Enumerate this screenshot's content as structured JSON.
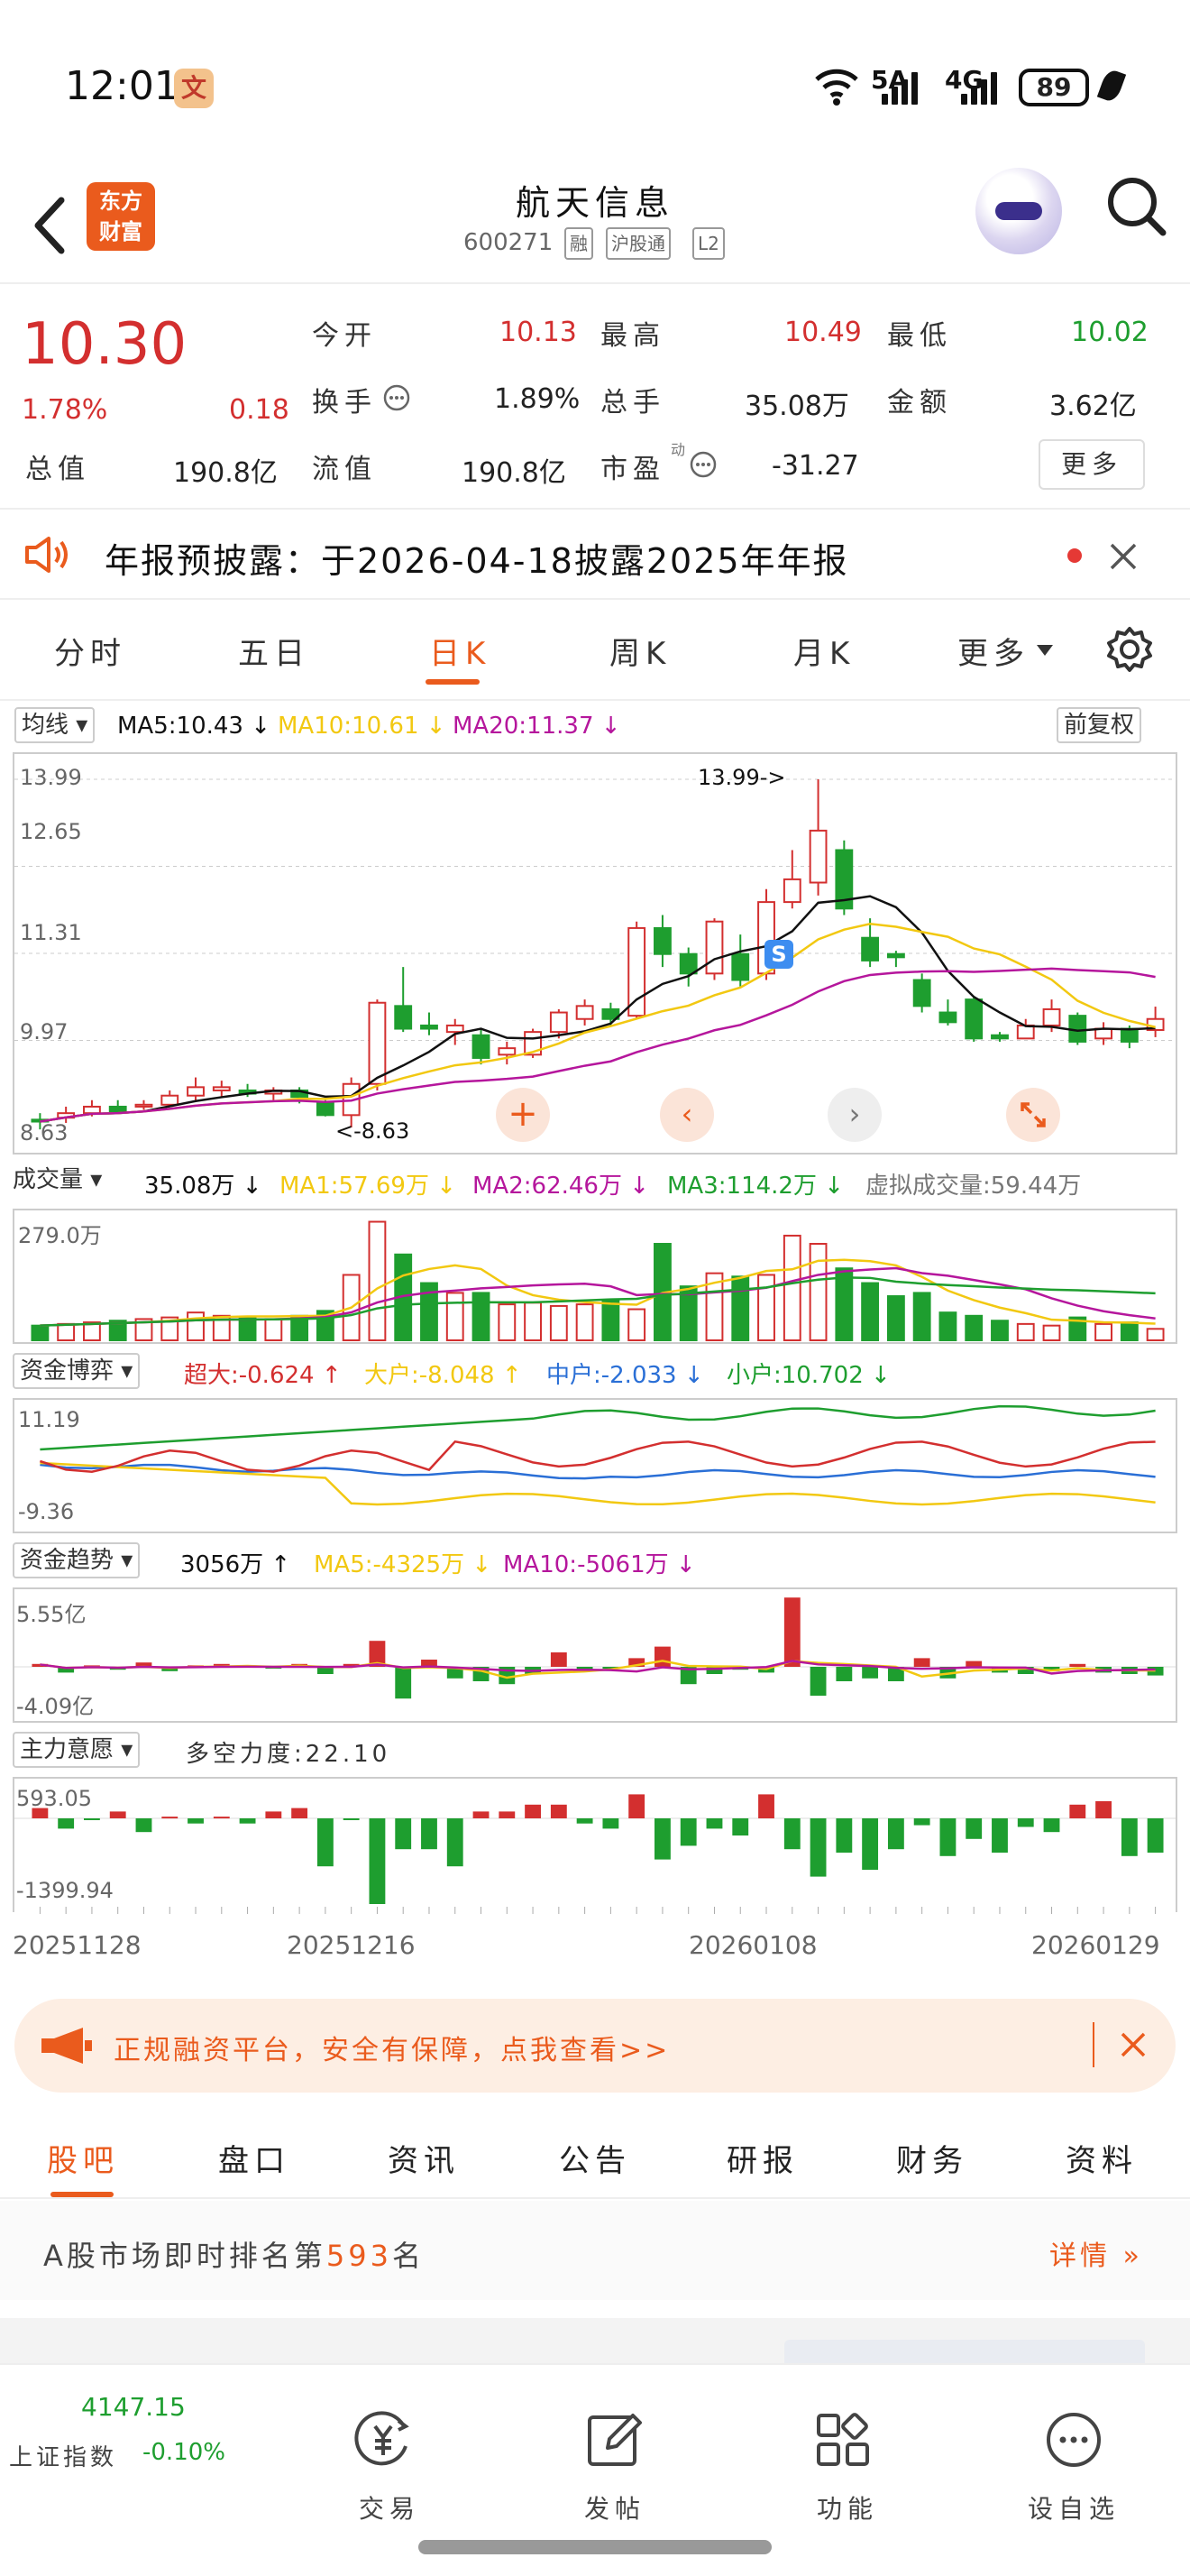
{
  "status": {
    "time": "12:01",
    "app_badge": "文",
    "net1": "5A",
    "net2": "4G",
    "battery": "89"
  },
  "header": {
    "title": "航天信息",
    "code": "600271",
    "tags": [
      "融",
      "沪股通",
      "L2"
    ],
    "logo_line1": "东方",
    "logo_line2": "财富"
  },
  "quote": {
    "price": "10.30",
    "change_pct": "1.78%",
    "change": "0.18",
    "open_label": "今开",
    "open": "10.13",
    "high_label": "最高",
    "high": "10.49",
    "low_label": "最低",
    "low": "10.02",
    "turnover_label": "换手",
    "turnover": "1.89%",
    "volume_label": "总手",
    "volume": "35.08万",
    "amount_label": "金额",
    "amount": "3.62亿",
    "mktcap_label": "总值",
    "mktcap": "190.8亿",
    "float_label": "流值",
    "float": "190.8亿",
    "pe_label": "市盈",
    "pe_sup": "动",
    "pe": "-31.27",
    "more": "更多"
  },
  "notice": {
    "text": "年报预披露：于2026-04-18披露2025年年报"
  },
  "ktabs": [
    "分时",
    "五日",
    "日K",
    "周K",
    "月K",
    "更多"
  ],
  "ma": {
    "selector": "均线",
    "ma5": "MA5:10.43",
    "ma10": "MA10:10.61",
    "ma20": "MA20:11.37",
    "adjust": "前复权"
  },
  "kchart": {
    "y_labels": [
      "13.99",
      "12.65",
      "11.31",
      "9.97",
      "8.63"
    ],
    "max_marker": "13.99->",
    "min_marker": "<-8.63",
    "s_marker": "S"
  },
  "vol": {
    "selector": "成交量",
    "value": "35.08万",
    "ma1": "MA1:57.69万",
    "ma2": "MA2:62.46万",
    "ma3": "MA3:114.2万",
    "virtual": "虚拟成交量:59.44万",
    "ymax": "279.0万"
  },
  "game": {
    "selector": "资金博弈",
    "xl": "超大:-0.624",
    "l": "大户:-8.048",
    "m": "中户:-2.033",
    "s": "小户:10.702",
    "ymax": "11.19",
    "ymin": "-9.36"
  },
  "trend": {
    "selector": "资金趋势",
    "value": "3056万",
    "ma5": "MA5:-4325万",
    "ma10": "MA10:-5061万",
    "ymax": "5.55亿",
    "ymin": "-4.09亿"
  },
  "will": {
    "selector": "主力意愿",
    "text": "多空力度:22.10",
    "ymax": "593.05",
    "ymin": "-1399.94"
  },
  "dates": [
    "20251128",
    "20251216",
    "20260108",
    "20260129"
  ],
  "promo": {
    "text": "正规融资平台，安全有保障，点我查看>>"
  },
  "ctabs": [
    "股吧",
    "盘口",
    "资讯",
    "公告",
    "研报",
    "财务",
    "资料"
  ],
  "rank": {
    "prefix": "A股市场即时排名第",
    "num": "593",
    "suffix": "名",
    "detail": "详情"
  },
  "bottom": {
    "index_value": "4147.15",
    "index_name": "上证指数",
    "index_pct": "-0.10%",
    "nav": [
      "交易",
      "发帖",
      "功能",
      "设自选"
    ]
  },
  "colors": {
    "up": "#d32f2f",
    "down": "#1e9e2f",
    "accent": "#ea5b1d",
    "ma5": "#111111",
    "ma10": "#f2c811",
    "ma20": "#b5169c"
  },
  "chart_data": [
    {
      "type": "candlestick",
      "title": "",
      "ylim": [
        8.63,
        13.99
      ],
      "candles": [
        [
          8.75,
          8.72,
          8.85,
          8.6
        ],
        [
          8.78,
          8.85,
          8.95,
          8.7
        ],
        [
          8.85,
          8.95,
          9.05,
          8.8
        ],
        [
          8.95,
          8.88,
          9.05,
          8.85
        ],
        [
          8.95,
          8.98,
          9.05,
          8.9
        ],
        [
          8.98,
          9.12,
          9.2,
          8.95
        ],
        [
          9.12,
          9.25,
          9.4,
          9.05
        ],
        [
          9.2,
          9.25,
          9.35,
          9.1
        ],
        [
          9.2,
          9.15,
          9.3,
          9.1
        ],
        [
          9.15,
          9.2,
          9.25,
          9.05
        ],
        [
          9.2,
          9.1,
          9.25,
          9.0
        ],
        [
          9.0,
          8.82,
          9.05,
          8.8
        ],
        [
          8.82,
          9.3,
          9.4,
          8.63
        ],
        [
          9.3,
          10.55,
          10.6,
          9.2
        ],
        [
          10.5,
          10.15,
          11.1,
          10.1
        ],
        [
          10.2,
          10.15,
          10.4,
          10.05
        ],
        [
          10.1,
          10.2,
          10.3,
          9.9
        ],
        [
          10.05,
          9.7,
          10.15,
          9.6
        ],
        [
          9.75,
          9.85,
          9.95,
          9.6
        ],
        [
          9.75,
          10.1,
          10.15,
          9.7
        ],
        [
          10.1,
          10.4,
          10.45,
          10.0
        ],
        [
          10.3,
          10.5,
          10.6,
          10.2
        ],
        [
          10.45,
          10.3,
          10.55,
          10.2
        ],
        [
          10.35,
          11.7,
          11.8,
          10.3
        ],
        [
          11.7,
          11.3,
          11.9,
          11.1
        ],
        [
          11.3,
          11.0,
          11.4,
          10.8
        ],
        [
          11.0,
          11.8,
          11.85,
          10.9
        ],
        [
          11.3,
          10.9,
          11.6,
          10.8
        ],
        [
          11.0,
          12.1,
          12.3,
          10.9
        ],
        [
          12.1,
          12.45,
          12.9,
          12.0
        ],
        [
          12.4,
          13.2,
          13.99,
          12.2
        ],
        [
          12.9,
          12.0,
          13.05,
          11.9
        ],
        [
          11.55,
          11.2,
          11.85,
          11.1
        ],
        [
          11.3,
          11.25,
          11.35,
          11.1
        ],
        [
          10.9,
          10.5,
          11.0,
          10.4
        ],
        [
          10.4,
          10.25,
          10.6,
          10.2
        ],
        [
          10.6,
          10.0,
          10.65,
          9.95
        ],
        [
          10.05,
          10.0,
          10.1,
          9.95
        ],
        [
          10.0,
          10.2,
          10.3,
          10.0
        ],
        [
          10.2,
          10.45,
          10.6,
          10.1
        ],
        [
          10.35,
          9.95,
          10.4,
          9.9
        ],
        [
          10.0,
          10.15,
          10.25,
          9.9
        ],
        [
          10.15,
          9.95,
          10.2,
          9.85
        ],
        [
          10.13,
          10.3,
          10.49,
          10.02
        ]
      ]
    }
  ]
}
